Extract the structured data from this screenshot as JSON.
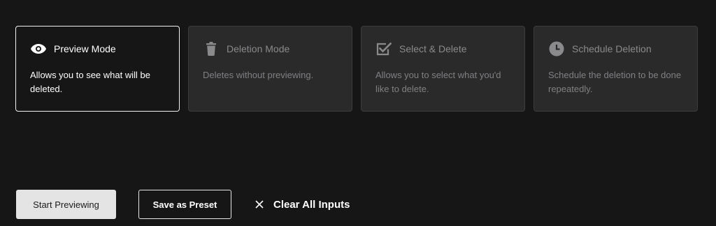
{
  "modes": [
    {
      "icon": "eye-icon",
      "title": "Preview Mode",
      "description": "Allows you to see what will be deleted.",
      "active": true
    },
    {
      "icon": "trash-icon",
      "title": "Deletion Mode",
      "description": "Deletes without previewing.",
      "active": false
    },
    {
      "icon": "checkbox-icon",
      "title": "Select & Delete",
      "description": "Allows you to select what you'd like to delete.",
      "active": false
    },
    {
      "icon": "clock-icon",
      "title": "Schedule Deletion",
      "description": "Schedule the deletion to be done repeatedly.",
      "active": false
    }
  ],
  "actions": {
    "start_label": "Start Previewing",
    "preset_label": "Save as Preset",
    "clear_label": "Clear All Inputs",
    "clear_icon": "close-icon"
  },
  "colors": {
    "background": "#161617",
    "card_inactive": "#2a2a2b",
    "text_active": "#ffffff",
    "text_inactive": "#8a8a8c",
    "primary_button": "#e4e4e4"
  }
}
